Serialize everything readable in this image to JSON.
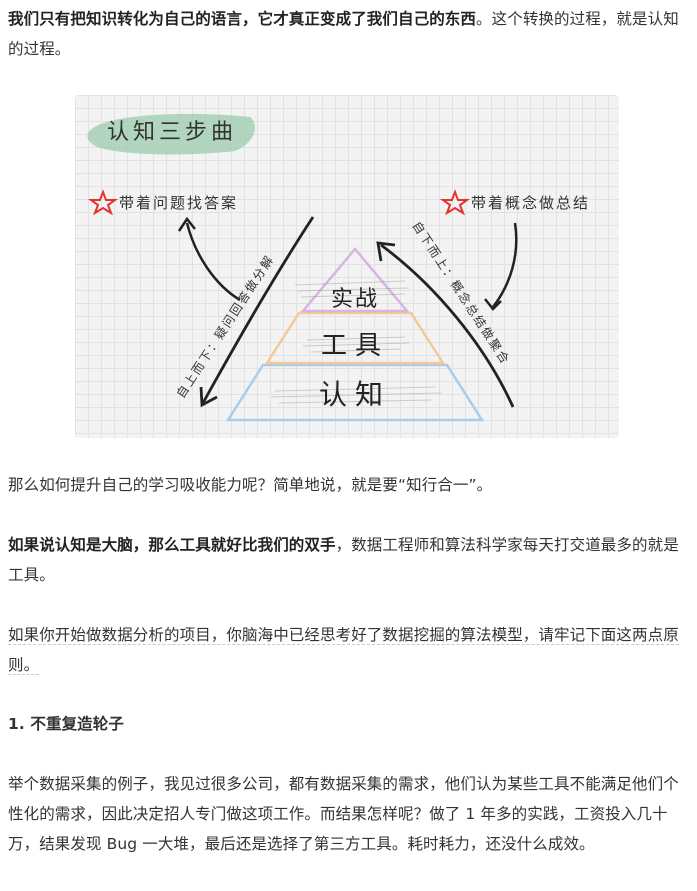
{
  "paragraphs": {
    "p1_bold": "我们只有把知识转化为自己的语言，它才真正变成了我们自己的东西",
    "p1_rest": "。这个转换的过程，就是认知的过程。",
    "p2": "那么如何提升自己的学习吸收能力呢？简单地说，就是要“知行合一”。",
    "p3_bold": "如果说认知是大脑，那么工具就好比我们的双手",
    "p3_rest": "，数据工程师和算法科学家每天打交道最多的就是工具。",
    "p4": "如果你开始做数据分析的项目，你脑海中已经思考好了数据挖掘的算法模型，请牢记下面这两点原则。",
    "heading": "1. 不重复造轮子",
    "p5": "举个数据采集的例子，我见过很多公司，都有数据采集的需求，他们认为某些工具不能满足他们个性化的需求，因此决定招人专门做这项工作。而结果怎样呢？做了 1 年多的实践，工资投入几十万，结果发现 Bug 一大堆，最后还是选择了第三方工具。耗时耗力，还没什么成效。"
  },
  "figure": {
    "title": "认知三步曲",
    "left_note": "带着问题找答案",
    "right_note": "带着概念做总结",
    "left_arrow_text": "自上而下：疑问回答做分解",
    "right_arrow_text": "自下而上：概念总结做聚合",
    "level_top": "实战",
    "level_mid": "工具",
    "level_bottom": "认知",
    "colors": {
      "title_highlight": "#8fc5a2",
      "star_red": "#e0352b",
      "tier_top": "#d8b4e0",
      "tier_mid": "#f5c89a",
      "tier_bottom": "#a9cde8"
    }
  }
}
